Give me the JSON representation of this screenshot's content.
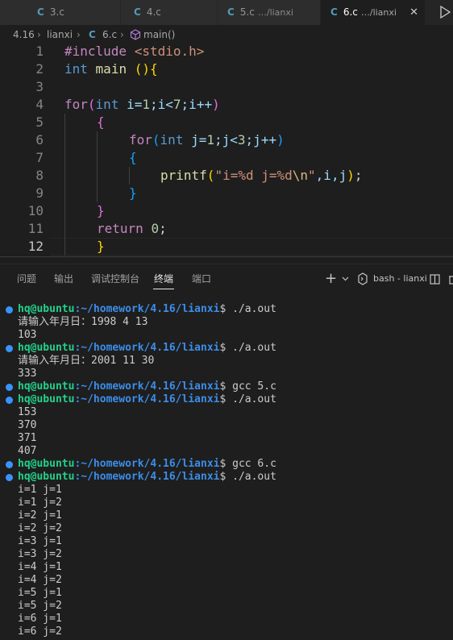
{
  "tabs": [
    {
      "label": "3.c",
      "suffix": ""
    },
    {
      "label": "4.c",
      "suffix": ""
    },
    {
      "label": "5.c",
      "suffix": "…/lianxi"
    },
    {
      "label": "6.c",
      "suffix": "…/lianxi"
    }
  ],
  "tab_icon_letter": "C",
  "breadcrumb": {
    "folder1": "4.16",
    "folder2": "lianxi",
    "file": "6.c",
    "symbol": "main()"
  },
  "editor": {
    "line_numbers": [
      "1",
      "2",
      "3",
      "4",
      "5",
      "6",
      "7",
      "8",
      "9",
      "10",
      "11",
      "12"
    ],
    "lines": {
      "l1_kw": "#include",
      "l1_hdr": "<stdio.h>",
      "l2_type": "int",
      "l2_name": "main",
      "l2_open": "(",
      "l2_close": ")",
      "l2_brace": "{",
      "l4_for": "for",
      "l4_open": "(",
      "l4_type": "int",
      "l4_a": "i=",
      "l4_n1": "1",
      "l4_b": ";i<",
      "l4_n2": "7",
      "l4_c": ";i++",
      "l4_close": ")",
      "l5_brace": "{",
      "l6_for": "for",
      "l6_open": "(",
      "l6_type": "int",
      "l6_a": "j=",
      "l6_n1": "1",
      "l6_b": ";j<",
      "l6_n2": "3",
      "l6_c": ";j++",
      "l6_close": ")",
      "l7_brace": "{",
      "l8_fn": "printf",
      "l8_open": "(",
      "l8_str1": "\"i=%d j=%d",
      "l8_esc": "\\n",
      "l8_str2": "\"",
      "l8_args": ",i,j",
      "l8_close": ")",
      "l8_semi": ";",
      "l9_brace": "}",
      "l10_brace": "}",
      "l11_ret": "return",
      "l11_num": "0",
      "l11_semi": ";",
      "l12_brace": "}"
    }
  },
  "panel": {
    "tabs": [
      "问题",
      "输出",
      "调试控制台",
      "终端",
      "端口"
    ],
    "active_tab": "终端",
    "terminal_name": "bash - lianxi",
    "add_label": "+"
  },
  "terminal": {
    "user": "hq@ubuntu",
    "path": ":~/homework/4.16/lianxi",
    "prompt_sign": "$",
    "lines": [
      {
        "type": "prompt",
        "cmd": " ./a.out"
      },
      {
        "type": "out",
        "text": "请输入年月日：1998 4 13"
      },
      {
        "type": "out",
        "text": "103"
      },
      {
        "type": "prompt",
        "cmd": " ./a.out"
      },
      {
        "type": "out",
        "text": "请输入年月日：2001 11 30"
      },
      {
        "type": "out",
        "text": "333"
      },
      {
        "type": "prompt",
        "cmd": " gcc 5.c"
      },
      {
        "type": "prompt",
        "cmd": " ./a.out"
      },
      {
        "type": "out",
        "text": "153"
      },
      {
        "type": "out",
        "text": "370"
      },
      {
        "type": "out",
        "text": "371"
      },
      {
        "type": "out",
        "text": "407"
      },
      {
        "type": "prompt",
        "cmd": " gcc 6.c"
      },
      {
        "type": "prompt",
        "cmd": " ./a.out"
      },
      {
        "type": "out",
        "text": "i=1 j=1"
      },
      {
        "type": "out",
        "text": "i=1 j=2"
      },
      {
        "type": "out",
        "text": "i=2 j=1"
      },
      {
        "type": "out",
        "text": "i=2 j=2"
      },
      {
        "type": "out",
        "text": "i=3 j=1"
      },
      {
        "type": "out",
        "text": "i=3 j=2"
      },
      {
        "type": "out",
        "text": "i=4 j=1"
      },
      {
        "type": "out",
        "text": "i=4 j=2"
      },
      {
        "type": "out",
        "text": "i=5 j=1"
      },
      {
        "type": "out",
        "text": "i=5 j=2"
      },
      {
        "type": "out",
        "text": "i=6 j=1"
      },
      {
        "type": "out",
        "text": "i=6 j=2"
      }
    ]
  },
  "colors": {
    "accent": "#3794ff",
    "prompt_user": "#23d18b",
    "prompt_path": "#3b8eea",
    "c_icon": "#519aba"
  }
}
